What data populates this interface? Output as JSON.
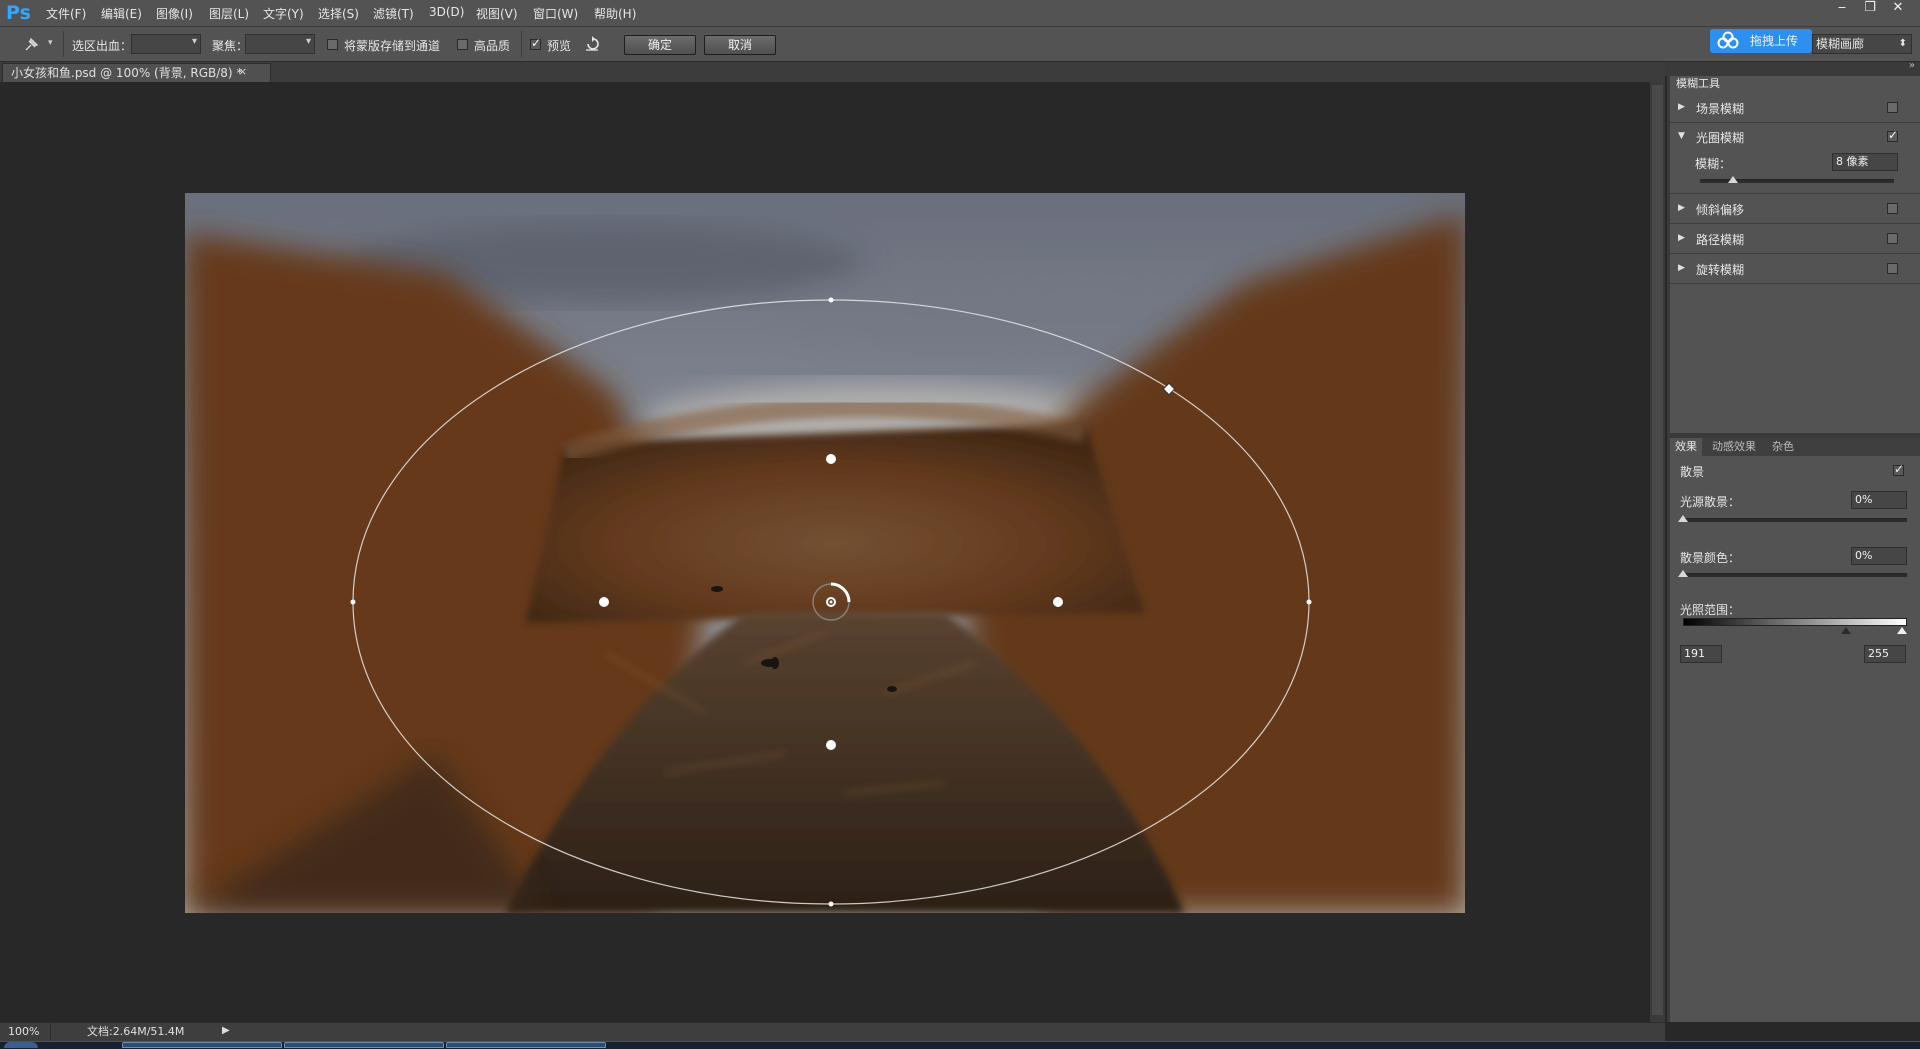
{
  "app": {
    "logo": "Ps"
  },
  "menu": [
    "文件(F)",
    "编辑(E)",
    "图像(I)",
    "图层(L)",
    "文字(Y)",
    "选择(S)",
    "滤镜(T)",
    "3D(D)",
    "视图(V)",
    "窗口(W)",
    "帮助(H)"
  ],
  "window_controls": {
    "minimize": "‒",
    "restore": "❐",
    "close": "✕"
  },
  "options": {
    "selection_bleed_label": "选区出血：",
    "focus_label": "聚焦：",
    "save_mask_label": "将蒙版存储到通道",
    "save_mask_checked": false,
    "high_quality_label": "高品质",
    "high_quality_checked": false,
    "preview_label": "预览",
    "preview_checked": true,
    "ok_label": "确定",
    "cancel_label": "取消",
    "upload_label": "拖拽上传",
    "workspace": "模糊画廊"
  },
  "document": {
    "tab_title": "小女孩和鱼.psd @ 100% (背景, RGB/8) *",
    "close": "×"
  },
  "blur_tools": {
    "panel_title": "模糊工具",
    "items": [
      {
        "label": "场景模糊",
        "expanded": false,
        "checked": false
      },
      {
        "label": "光圈模糊",
        "expanded": true,
        "checked": true
      },
      {
        "label": "倾斜偏移",
        "expanded": false,
        "checked": false
      },
      {
        "label": "路径模糊",
        "expanded": false,
        "checked": false
      },
      {
        "label": "旋转模糊",
        "expanded": false,
        "checked": false
      }
    ],
    "blur_label": "模糊：",
    "blur_value": "8 像素",
    "blur_fraction": 0.17
  },
  "effects": {
    "tabs": [
      "效果",
      "动感效果",
      "杂色"
    ],
    "bokeh_label": "散景",
    "bokeh_checked": true,
    "light_bokeh_label": "光源散景：",
    "light_bokeh_value": "0%",
    "light_bokeh_fraction": 0,
    "bokeh_color_label": "散景颜色：",
    "bokeh_color_value": "0%",
    "bokeh_color_fraction": 0,
    "light_range_label": "光照范围：",
    "light_range_low": "191",
    "light_range_high": "255"
  },
  "status": {
    "zoom": "100%",
    "doc_size": "文档:2.64M/51.4M"
  },
  "icons": {
    "tool": "pin-icon",
    "reset": "reset-icon",
    "upload": "cloud-icon"
  }
}
